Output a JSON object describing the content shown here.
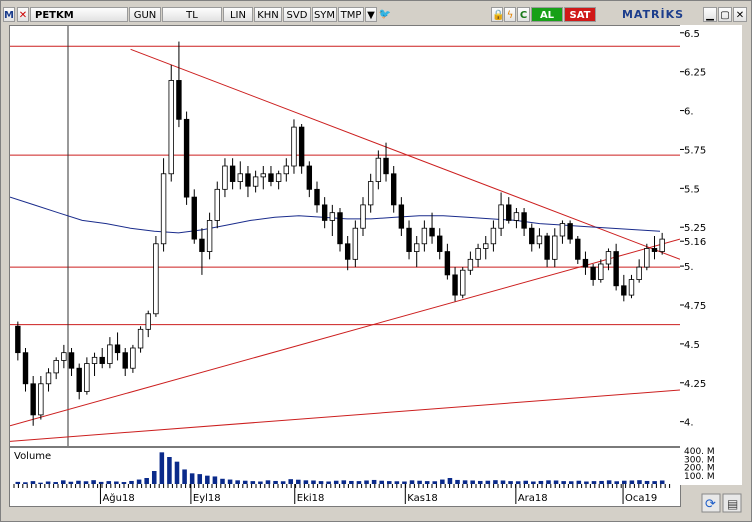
{
  "toolbar": {
    "brand_icon": "M",
    "symbol": "PETKM",
    "period": "GUN",
    "currency": "TL",
    "scale_lin": "LIN",
    "btn_khn": "KHN",
    "btn_svd": "SVD",
    "btn_sym": "SYM",
    "btn_tmp": "TMP",
    "buy": "AL",
    "sell": "SAT",
    "app_name": "MATRİKS",
    "refresh_symbol": "C"
  },
  "colors": {
    "candle_up": "#ffffff",
    "candle_down": "#000000",
    "trend_red": "#cc1f1f",
    "ma_blue": "#1a2c8c"
  },
  "chart_data": {
    "type": "candlestick",
    "ylim": [
      3.85,
      6.55
    ],
    "y_ticks": [
      "6.5",
      "6.25",
      "6.",
      "5.75",
      "5.5",
      "5.25",
      "5.16",
      "5.",
      "4.75",
      "4.5",
      "4.25",
      "4."
    ],
    "x_labels": [
      "Ağu18",
      "Eyl18",
      "Eki18",
      "Kas18",
      "Ara18",
      "Oca19"
    ],
    "horizontal_levels": [
      6.42,
      5.72,
      5.0,
      4.63
    ],
    "trendlines": [
      {
        "from": [
          0.18,
          6.4
        ],
        "to": [
          1.0,
          5.05
        ]
      },
      {
        "from": [
          0.0,
          3.98
        ],
        "to": [
          1.0,
          5.18
        ]
      },
      {
        "from": [
          0.0,
          3.88
        ],
        "to": [
          1.0,
          4.21
        ]
      }
    ],
    "ohlc": [
      [
        4.62,
        4.65,
        4.4,
        4.45
      ],
      [
        4.45,
        4.48,
        4.2,
        4.25
      ],
      [
        4.25,
        4.3,
        3.98,
        4.05
      ],
      [
        4.05,
        4.3,
        4.02,
        4.25
      ],
      [
        4.25,
        4.35,
        4.2,
        4.32
      ],
      [
        4.32,
        4.42,
        4.28,
        4.4
      ],
      [
        4.4,
        4.5,
        4.35,
        4.45
      ],
      [
        4.45,
        4.48,
        4.3,
        4.35
      ],
      [
        4.35,
        4.38,
        4.15,
        4.2
      ],
      [
        4.2,
        4.42,
        4.18,
        4.38
      ],
      [
        4.38,
        4.45,
        4.3,
        4.42
      ],
      [
        4.42,
        4.48,
        4.35,
        4.38
      ],
      [
        4.38,
        4.55,
        4.35,
        4.5
      ],
      [
        4.5,
        4.58,
        4.4,
        4.45
      ],
      [
        4.45,
        4.48,
        4.3,
        4.35
      ],
      [
        4.35,
        4.5,
        4.32,
        4.48
      ],
      [
        4.48,
        4.62,
        4.45,
        4.6
      ],
      [
        4.6,
        4.72,
        4.55,
        4.7
      ],
      [
        4.7,
        5.2,
        4.68,
        5.15
      ],
      [
        5.15,
        5.7,
        5.1,
        5.6
      ],
      [
        5.6,
        6.3,
        5.55,
        6.2
      ],
      [
        6.2,
        6.45,
        5.9,
        5.95
      ],
      [
        5.95,
        6.0,
        5.4,
        5.45
      ],
      [
        5.45,
        5.5,
        5.15,
        5.18
      ],
      [
        5.18,
        5.25,
        4.95,
        5.1
      ],
      [
        5.1,
        5.35,
        5.05,
        5.3
      ],
      [
        5.3,
        5.55,
        5.25,
        5.5
      ],
      [
        5.5,
        5.7,
        5.45,
        5.65
      ],
      [
        5.65,
        5.7,
        5.5,
        5.55
      ],
      [
        5.55,
        5.68,
        5.5,
        5.6
      ],
      [
        5.6,
        5.65,
        5.45,
        5.52
      ],
      [
        5.52,
        5.62,
        5.48,
        5.58
      ],
      [
        5.58,
        5.65,
        5.5,
        5.6
      ],
      [
        5.6,
        5.65,
        5.52,
        5.55
      ],
      [
        5.55,
        5.62,
        5.5,
        5.6
      ],
      [
        5.6,
        5.7,
        5.55,
        5.65
      ],
      [
        5.65,
        5.95,
        5.6,
        5.9
      ],
      [
        5.9,
        5.92,
        5.6,
        5.65
      ],
      [
        5.65,
        5.68,
        5.45,
        5.5
      ],
      [
        5.5,
        5.55,
        5.35,
        5.4
      ],
      [
        5.4,
        5.45,
        5.25,
        5.3
      ],
      [
        5.3,
        5.4,
        5.2,
        5.35
      ],
      [
        5.35,
        5.38,
        5.1,
        5.15
      ],
      [
        5.15,
        5.2,
        4.98,
        5.05
      ],
      [
        5.05,
        5.3,
        5.0,
        5.25
      ],
      [
        5.25,
        5.45,
        5.2,
        5.4
      ],
      [
        5.4,
        5.6,
        5.35,
        5.55
      ],
      [
        5.55,
        5.75,
        5.5,
        5.7
      ],
      [
        5.7,
        5.8,
        5.55,
        5.6
      ],
      [
        5.6,
        5.65,
        5.35,
        5.4
      ],
      [
        5.4,
        5.45,
        5.2,
        5.25
      ],
      [
        5.25,
        5.3,
        5.05,
        5.1
      ],
      [
        5.1,
        5.2,
        5.0,
        5.15
      ],
      [
        5.15,
        5.3,
        5.1,
        5.25
      ],
      [
        5.25,
        5.35,
        5.15,
        5.2
      ],
      [
        5.2,
        5.25,
        5.05,
        5.1
      ],
      [
        5.1,
        5.15,
        4.92,
        4.95
      ],
      [
        4.95,
        5.0,
        4.78,
        4.82
      ],
      [
        4.82,
        5.0,
        4.8,
        4.98
      ],
      [
        4.98,
        5.1,
        4.95,
        5.05
      ],
      [
        5.05,
        5.15,
        5.0,
        5.12
      ],
      [
        5.12,
        5.2,
        5.05,
        5.15
      ],
      [
        5.15,
        5.3,
        5.1,
        5.25
      ],
      [
        5.25,
        5.48,
        5.2,
        5.4
      ],
      [
        5.4,
        5.45,
        5.28,
        5.3
      ],
      [
        5.3,
        5.38,
        5.25,
        5.35
      ],
      [
        5.35,
        5.38,
        5.2,
        5.25
      ],
      [
        5.25,
        5.28,
        5.1,
        5.15
      ],
      [
        5.15,
        5.25,
        5.12,
        5.2
      ],
      [
        5.2,
        5.22,
        5.0,
        5.05
      ],
      [
        5.05,
        5.25,
        5.0,
        5.2
      ],
      [
        5.2,
        5.3,
        5.15,
        5.28
      ],
      [
        5.28,
        5.3,
        5.15,
        5.18
      ],
      [
        5.18,
        5.2,
        5.02,
        5.05
      ],
      [
        5.05,
        5.1,
        4.95,
        5.0
      ],
      [
        5.0,
        5.02,
        4.88,
        4.92
      ],
      [
        4.92,
        5.05,
        4.9,
        5.02
      ],
      [
        5.02,
        5.12,
        4.98,
        5.1
      ],
      [
        5.1,
        5.15,
        4.85,
        4.88
      ],
      [
        4.88,
        4.95,
        4.78,
        4.82
      ],
      [
        4.82,
        4.95,
        4.8,
        4.92
      ],
      [
        4.92,
        5.05,
        4.9,
        5.0
      ],
      [
        5.0,
        5.15,
        4.98,
        5.12
      ],
      [
        5.12,
        5.2,
        5.05,
        5.1
      ],
      [
        5.1,
        5.22,
        5.08,
        5.18
      ]
    ],
    "ma": [
      5.45,
      5.4,
      5.35,
      5.3,
      5.28,
      5.25,
      5.23,
      5.22,
      5.24,
      5.27,
      5.3,
      5.32,
      5.33,
      5.32,
      5.31,
      5.31,
      5.32,
      5.33,
      5.33,
      5.32,
      5.31,
      5.3,
      5.28,
      5.27,
      5.26,
      5.25,
      5.24,
      5.23
    ],
    "volume": {
      "label": "Volume",
      "ticks": [
        "400. M",
        "300. M",
        "200. M",
        "100. M"
      ],
      "max": 450,
      "values": [
        40,
        35,
        50,
        30,
        45,
        38,
        60,
        42,
        55,
        48,
        62,
        40,
        50,
        45,
        38,
        52,
        70,
        90,
        180,
        420,
        360,
        300,
        200,
        150,
        140,
        120,
        110,
        80,
        70,
        60,
        55,
        50,
        45,
        60,
        52,
        48,
        75,
        68,
        60,
        58,
        50,
        45,
        55,
        60,
        52,
        50,
        58,
        65,
        55,
        50,
        48,
        45,
        60,
        55,
        50,
        48,
        70,
        90,
        65,
        60,
        58,
        52,
        55,
        62,
        58,
        50,
        48,
        55,
        45,
        52,
        60,
        58,
        50,
        48,
        55,
        45,
        50,
        52,
        60,
        48,
        55,
        58,
        62,
        52,
        50,
        58
      ]
    }
  }
}
